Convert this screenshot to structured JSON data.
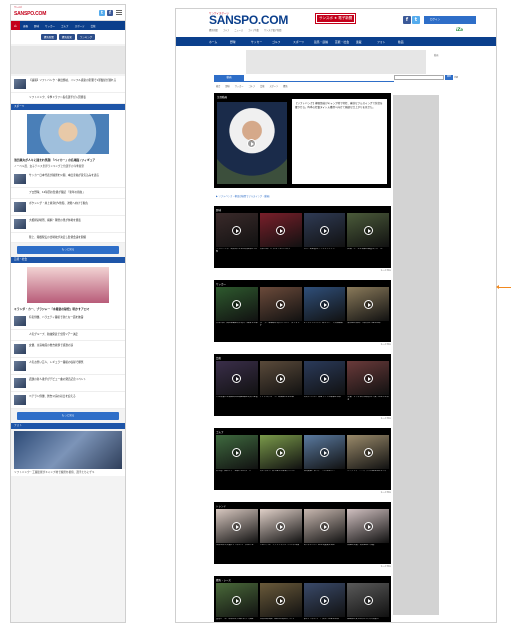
{
  "mobile": {
    "logo_tag": "サンスポ",
    "logo": "SANSPO.COM",
    "twitter": "t",
    "facebook": "f",
    "nav": [
      "速報",
      "野球",
      "サッカー",
      "ゴルフ",
      "スポーツ",
      "芸能"
    ],
    "home_label": "⌂",
    "subnav": [
      "競馬新聞",
      "競馬結果",
      "ランキング"
    ],
    "items1": [
      {
        "text": "【速報】ソフトバンク・柳田悠岐、インフル感染の影響で1軍復帰が遅れる"
      },
      {
        "text": "ソフトバンク、今季ドラフト指名選手が入団発表"
      }
    ],
    "section1": "スポーツ",
    "hero1_caption": "浅田真央が人々に囲まれ笑顔 「ベイカー」の名場面 /フィギュア",
    "hero1_sub": "ノーベル賞、女子テニス世界ランキング上位選手の今季展望",
    "items2": [
      {
        "text": "サッカー日本代表が練習を公開、本田圭佑が意気込みを語る"
      },
      {
        "text": "プロ野球、12球団の監督が集結 「新年の抱負」"
      },
      {
        "text": "ボクシング・井上尚弥がV防衛、次戦へ向けて抱負"
      },
      {
        "text": "大相撲初場所、横綱・稀勢の里が休場を発表"
      },
      {
        "text": "陸上、箱根駅伝の出場校が決定し監督会議を開催"
      }
    ],
    "more1": "もっと見る",
    "section2": "芸能・社会",
    "hero2_caption": "ミランダ・カー、ブラジャー「水着姿の秘密」明かすアロマ",
    "items3": [
      {
        "text": "有名俳優、バラエティ番組で新たな一面を披露"
      },
      {
        "text": "人気グループ、新曲発表で全国ツアー決定"
      },
      {
        "text": "女優、主演映画の舞台挨拶で感激の涙"
      },
      {
        "text": "人気お笑い芸人、レギュラー番組の収録で爆笑"
      },
      {
        "text": "話題の新人歌手がデビュー曲の発売記念イベント"
      },
      {
        "text": "ベテラン俳優、舞台公演の初日を迎える"
      }
    ],
    "more2": "もっと見る",
    "section3": "フォト",
    "hero3_caption": "ソフトバンク・工藤監督がキャンプ地で練習を視察、選手たちにゲキ"
  },
  "desktop": {
    "logo_small": "サンケイスポーツ",
    "logo_main": "SANSPO",
    "logo_dot": ".COM",
    "badge": "サンスポ ★ 電子新聞",
    "facebook": "f",
    "twitter": "t",
    "head_button": "ログイン",
    "subnav": [
      "競馬新聞",
      "ゴルフ",
      "ニュース",
      "ゴルフ特集",
      "サンスポ電子新聞"
    ],
    "logo2": "iZa",
    "nav": [
      "ホーム",
      "野球",
      "サッカー",
      "ゴルフ",
      "スポーツ",
      "競馬・競輪",
      "芸能・社会",
      "連載",
      "フォト",
      "動画"
    ],
    "nav_right": "動画",
    "search_button": "検索",
    "search_label": "詳細",
    "tab": "動画",
    "tabs2": [
      "総合",
      "野球",
      "サッカー",
      "ゴルフ",
      "芸能",
      "スポーツ",
      "競馬"
    ],
    "featured_label": "注目動画",
    "featured_text": "【ソフトバンク】柳田悠岐がキャンプ地で特打、豪快なフルスイングで快音を響かせる。昨季の打撃タイトル獲得へ向けて順調な仕上がりを見せた。",
    "link": "▶ ソフトバンク・柳田が練習でフルスイング（動画）",
    "blocks": [
      {
        "title": "野球",
        "cells": [
          "ソフトバンク、新外国人が初の実戦形式で打撃",
          "日本ハム、ドラ1がブルペン入り",
          "巨人、新監督の下でキャンプイン",
          "広島、エースが順調な調整をアピール"
        ]
      },
      {
        "title": "サッカー",
        "cells": [
          "日本代表、国際親善試合に向けて練習を公開",
          "Jリーグ、開幕戦に向けたプレシーズンマッチ",
          "なでしこジャパン、新メンバーで合宿開始",
          "海外組が帰国、代表合流へ意気込み"
        ]
      },
      {
        "title": "芸能",
        "cells": [
          "人気俳優が主演映画の完成披露試写会に登壇",
          "アイドルグループ、新曲MVを初公開",
          "お笑いコンビ、単独ライブの開催を発表",
          "女優、ドラマ制作発表会見で役への思いを語る"
        ]
      },
      {
        "title": "ゴルフ",
        "cells": [
          "石川遼、国内ツアー初戦で好スタート",
          "女子ゴルフ、若手選手が練習ラウンド",
          "松山英樹、米ツアーで上位争いへ",
          "シニアツアー、ベテランが意地の好スコア"
        ]
      },
      {
        "title": "トレンド",
        "cells": [
          "注目の若手女優がインタビューに応じる",
          "人気モデル、ファッションイベントに出演",
          "新人タレント、初の写真集を発売",
          "話題の女優、舞台挨拶で笑顔"
        ]
      },
      {
        "title": "競馬・レース",
        "cells": [
          "重賞レース、本命馬が力強い走りで快勝",
          "注目の新馬戦、期待の2歳馬がデビュー",
          "騎手インタビュー、次走への意気込み",
          "調教師が愛馬の仕上がりに太鼓判"
        ]
      }
    ],
    "more": "もっと見る"
  }
}
